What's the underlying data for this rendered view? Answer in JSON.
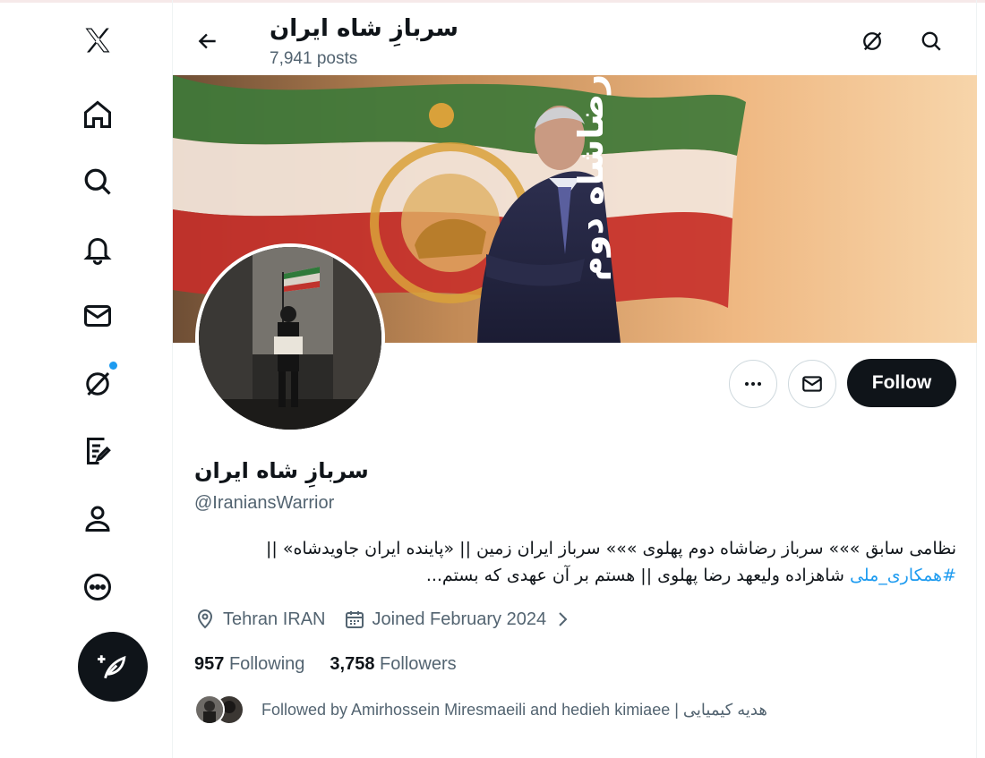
{
  "header": {
    "title": "سربازِ شاه ایران",
    "posts": "7,941 posts"
  },
  "profile": {
    "name": "سربازِ شاه ایران",
    "handle": "@IraniansWarrior",
    "bio_line1": "نظامی سابق »»» سرباز رضاشاه دوم پهلوی »»» سرباز ایران زمین || «پاینده ایران جاویدشاه» ||",
    "bio_tag": "#همکاری_ملی",
    "bio_line2_rest": " شاهزاده ولیعهد رضا پهلوی || هستم بر آن عهدی که بستم...",
    "banner_text": "رضاشاه دوم",
    "location": "Tehran IRAN",
    "joined": "Joined February 2024",
    "following_count": "957",
    "following_label": "Following",
    "followers_count": "3,758",
    "followers_label": "Followers",
    "followed_by": "Followed by Amirhossein Miresmaeili and hedieh kimiaee | هدیه کیمیایی"
  },
  "actions": {
    "follow_label": "Follow"
  },
  "colors": {
    "accent": "#1d9bf0",
    "text": "#0f1419",
    "muted": "#536471"
  }
}
